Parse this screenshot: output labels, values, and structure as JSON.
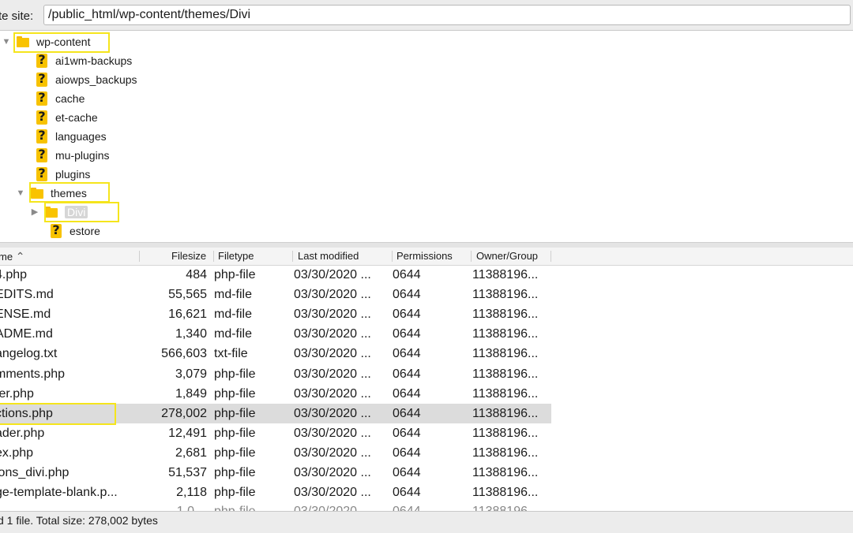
{
  "pathbar": {
    "label": "te site:",
    "path": "/public_html/wp-content/themes/Divi"
  },
  "tree": {
    "root": "wp-content",
    "children": [
      "ai1wm-backups",
      "aiowps_backups",
      "cache",
      "et-cache",
      "languages",
      "mu-plugins",
      "plugins"
    ],
    "themes": "themes",
    "divi": "Divi",
    "estore": "estore"
  },
  "list": {
    "headers": {
      "name": "me",
      "sort_arrow": "^",
      "filesize": "Filesize",
      "filetype": "Filetype",
      "modified": "Last modified",
      "permissions": "Permissions",
      "owner": "Owner/Group"
    },
    "rows": [
      {
        "name": "4.php",
        "size": "484",
        "type": "php-file",
        "modified": "03/30/2020 ...",
        "perm": "0644",
        "owner": "11388196..."
      },
      {
        "name": "EDITS.md",
        "size": "55,565",
        "type": "md-file",
        "modified": "03/30/2020 ...",
        "perm": "0644",
        "owner": "11388196..."
      },
      {
        "name": "ENSE.md",
        "size": "16,621",
        "type": "md-file",
        "modified": "03/30/2020 ...",
        "perm": "0644",
        "owner": "11388196..."
      },
      {
        "name": "ADME.md",
        "size": "1,340",
        "type": "md-file",
        "modified": "03/30/2020 ...",
        "perm": "0644",
        "owner": "11388196..."
      },
      {
        "name": "angelog.txt",
        "size": "566,603",
        "type": "txt-file",
        "modified": "03/30/2020 ...",
        "perm": "0644",
        "owner": "11388196..."
      },
      {
        "name": "mments.php",
        "size": "3,079",
        "type": "php-file",
        "modified": "03/30/2020 ...",
        "perm": "0644",
        "owner": "11388196..."
      },
      {
        "name": "ter.php",
        "size": "1,849",
        "type": "php-file",
        "modified": "03/30/2020 ...",
        "perm": "0644",
        "owner": "11388196..."
      },
      {
        "name": "ctions.php",
        "size": "278,002",
        "type": "php-file",
        "modified": "03/30/2020 ...",
        "perm": "0644",
        "owner": "11388196..."
      },
      {
        "name": "ader.php",
        "size": "12,491",
        "type": "php-file",
        "modified": "03/30/2020 ...",
        "perm": "0644",
        "owner": "11388196..."
      },
      {
        "name": "ex.php",
        "size": "2,681",
        "type": "php-file",
        "modified": "03/30/2020 ...",
        "perm": "0644",
        "owner": "11388196..."
      },
      {
        "name": "ions_divi.php",
        "size": "51,537",
        "type": "php-file",
        "modified": "03/30/2020 ...",
        "perm": "0644",
        "owner": "11388196..."
      },
      {
        "name": "ge-template-blank.p...",
        "size": "2,118",
        "type": "php-file",
        "modified": "03/30/2020 ...",
        "perm": "0644",
        "owner": "11388196..."
      }
    ]
  },
  "status": "d 1 file. Total size: 278,002 bytes",
  "colors": {
    "highlight_box": "#f5e51c",
    "folder": "#f9c300",
    "selected_row": "#dcdcdc"
  }
}
